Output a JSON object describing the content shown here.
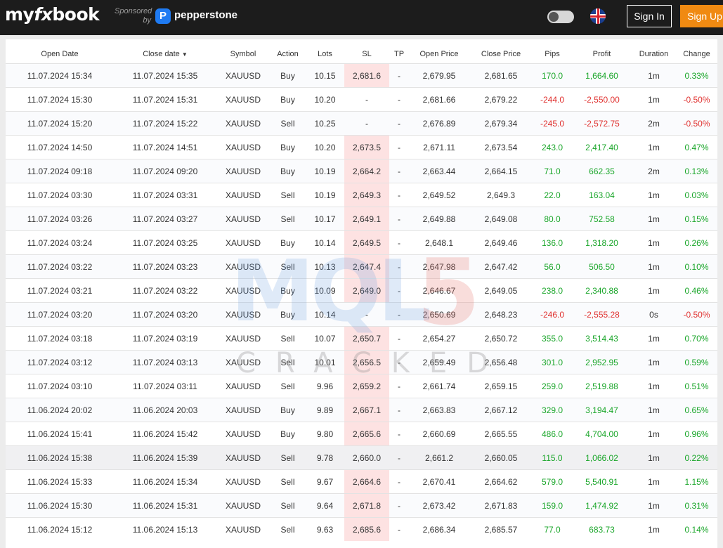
{
  "header": {
    "logo_my": "my",
    "logo_fx": "fx",
    "logo_book": "book",
    "sponsored_line1": "Sponsored",
    "sponsored_line2": "by",
    "sponsor_name": "pepperstone",
    "theme_toggle_icon": "toggle-icon",
    "language_icon": "uk-flag-icon",
    "signin_label": "Sign In",
    "signup_label": "Sign Up"
  },
  "table": {
    "columns": [
      "Open Date",
      "Close date",
      "Symbol",
      "Action",
      "Lots",
      "SL",
      "TP",
      "Open Price",
      "Close Price",
      "Pips",
      "Profit",
      "Duration",
      "Change"
    ],
    "sorted_column_marker": "▼",
    "rows": [
      {
        "open_date": "11.07.2024 15:34",
        "close_date": "11.07.2024 15:35",
        "symbol": "XAUUSD",
        "action": "Buy",
        "lots": "10.15",
        "sl": "2,681.6",
        "tp": "-",
        "open_price": "2,679.95",
        "close_price": "2,681.65",
        "pips": "170.0",
        "profit": "1,664.60",
        "duration": "1m",
        "change": "0.33%",
        "positive": true,
        "sl_hit": true
      },
      {
        "open_date": "11.07.2024 15:30",
        "close_date": "11.07.2024 15:31",
        "symbol": "XAUUSD",
        "action": "Buy",
        "lots": "10.20",
        "sl": "-",
        "tp": "-",
        "open_price": "2,681.66",
        "close_price": "2,679.22",
        "pips": "-244.0",
        "profit": "-2,550.00",
        "duration": "1m",
        "change": "-0.50%",
        "positive": false,
        "sl_hit": false
      },
      {
        "open_date": "11.07.2024 15:20",
        "close_date": "11.07.2024 15:22",
        "symbol": "XAUUSD",
        "action": "Sell",
        "lots": "10.25",
        "sl": "-",
        "tp": "-",
        "open_price": "2,676.89",
        "close_price": "2,679.34",
        "pips": "-245.0",
        "profit": "-2,572.75",
        "duration": "2m",
        "change": "-0.50%",
        "positive": false,
        "sl_hit": false
      },
      {
        "open_date": "11.07.2024 14:50",
        "close_date": "11.07.2024 14:51",
        "symbol": "XAUUSD",
        "action": "Buy",
        "lots": "10.20",
        "sl": "2,673.5",
        "tp": "-",
        "open_price": "2,671.11",
        "close_price": "2,673.54",
        "pips": "243.0",
        "profit": "2,417.40",
        "duration": "1m",
        "change": "0.47%",
        "positive": true,
        "sl_hit": true
      },
      {
        "open_date": "11.07.2024 09:18",
        "close_date": "11.07.2024 09:20",
        "symbol": "XAUUSD",
        "action": "Buy",
        "lots": "10.19",
        "sl": "2,664.2",
        "tp": "-",
        "open_price": "2,663.44",
        "close_price": "2,664.15",
        "pips": "71.0",
        "profit": "662.35",
        "duration": "2m",
        "change": "0.13%",
        "positive": true,
        "sl_hit": true
      },
      {
        "open_date": "11.07.2024 03:30",
        "close_date": "11.07.2024 03:31",
        "symbol": "XAUUSD",
        "action": "Sell",
        "lots": "10.19",
        "sl": "2,649.3",
        "tp": "-",
        "open_price": "2,649.52",
        "close_price": "2,649.3",
        "pips": "22.0",
        "profit": "163.04",
        "duration": "1m",
        "change": "0.03%",
        "positive": true,
        "sl_hit": true
      },
      {
        "open_date": "11.07.2024 03:26",
        "close_date": "11.07.2024 03:27",
        "symbol": "XAUUSD",
        "action": "Sell",
        "lots": "10.17",
        "sl": "2,649.1",
        "tp": "-",
        "open_price": "2,649.88",
        "close_price": "2,649.08",
        "pips": "80.0",
        "profit": "752.58",
        "duration": "1m",
        "change": "0.15%",
        "positive": true,
        "sl_hit": true
      },
      {
        "open_date": "11.07.2024 03:24",
        "close_date": "11.07.2024 03:25",
        "symbol": "XAUUSD",
        "action": "Buy",
        "lots": "10.14",
        "sl": "2,649.5",
        "tp": "-",
        "open_price": "2,648.1",
        "close_price": "2,649.46",
        "pips": "136.0",
        "profit": "1,318.20",
        "duration": "1m",
        "change": "0.26%",
        "positive": true,
        "sl_hit": true
      },
      {
        "open_date": "11.07.2024 03:22",
        "close_date": "11.07.2024 03:23",
        "symbol": "XAUUSD",
        "action": "Sell",
        "lots": "10.13",
        "sl": "2,647.4",
        "tp": "-",
        "open_price": "2,647.98",
        "close_price": "2,647.42",
        "pips": "56.0",
        "profit": "506.50",
        "duration": "1m",
        "change": "0.10%",
        "positive": true,
        "sl_hit": true
      },
      {
        "open_date": "11.07.2024 03:21",
        "close_date": "11.07.2024 03:22",
        "symbol": "XAUUSD",
        "action": "Buy",
        "lots": "10.09",
        "sl": "2,649.0",
        "tp": "-",
        "open_price": "2,646.67",
        "close_price": "2,649.05",
        "pips": "238.0",
        "profit": "2,340.88",
        "duration": "1m",
        "change": "0.46%",
        "positive": true,
        "sl_hit": true
      },
      {
        "open_date": "11.07.2024 03:20",
        "close_date": "11.07.2024 03:20",
        "symbol": "XAUUSD",
        "action": "Buy",
        "lots": "10.14",
        "sl": "-",
        "tp": "-",
        "open_price": "2,650.69",
        "close_price": "2,648.23",
        "pips": "-246.0",
        "profit": "-2,555.28",
        "duration": "0s",
        "change": "-0.50%",
        "positive": false,
        "sl_hit": false
      },
      {
        "open_date": "11.07.2024 03:18",
        "close_date": "11.07.2024 03:19",
        "symbol": "XAUUSD",
        "action": "Sell",
        "lots": "10.07",
        "sl": "2,650.7",
        "tp": "-",
        "open_price": "2,654.27",
        "close_price": "2,650.72",
        "pips": "355.0",
        "profit": "3,514.43",
        "duration": "1m",
        "change": "0.70%",
        "positive": true,
        "sl_hit": true
      },
      {
        "open_date": "11.07.2024 03:12",
        "close_date": "11.07.2024 03:13",
        "symbol": "XAUUSD",
        "action": "Sell",
        "lots": "10.01",
        "sl": "2,656.5",
        "tp": "-",
        "open_price": "2,659.49",
        "close_price": "2,656.48",
        "pips": "301.0",
        "profit": "2,952.95",
        "duration": "1m",
        "change": "0.59%",
        "positive": true,
        "sl_hit": true
      },
      {
        "open_date": "11.07.2024 03:10",
        "close_date": "11.07.2024 03:11",
        "symbol": "XAUUSD",
        "action": "Sell",
        "lots": "9.96",
        "sl": "2,659.2",
        "tp": "-",
        "open_price": "2,661.74",
        "close_price": "2,659.15",
        "pips": "259.0",
        "profit": "2,519.88",
        "duration": "1m",
        "change": "0.51%",
        "positive": true,
        "sl_hit": true
      },
      {
        "open_date": "11.06.2024 20:02",
        "close_date": "11.06.2024 20:03",
        "symbol": "XAUUSD",
        "action": "Buy",
        "lots": "9.89",
        "sl": "2,667.1",
        "tp": "-",
        "open_price": "2,663.83",
        "close_price": "2,667.12",
        "pips": "329.0",
        "profit": "3,194.47",
        "duration": "1m",
        "change": "0.65%",
        "positive": true,
        "sl_hit": true
      },
      {
        "open_date": "11.06.2024 15:41",
        "close_date": "11.06.2024 15:42",
        "symbol": "XAUUSD",
        "action": "Buy",
        "lots": "9.80",
        "sl": "2,665.6",
        "tp": "-",
        "open_price": "2,660.69",
        "close_price": "2,665.55",
        "pips": "486.0",
        "profit": "4,704.00",
        "duration": "1m",
        "change": "0.96%",
        "positive": true,
        "sl_hit": true
      },
      {
        "open_date": "11.06.2024 15:38",
        "close_date": "11.06.2024 15:39",
        "symbol": "XAUUSD",
        "action": "Sell",
        "lots": "9.78",
        "sl": "2,660.0",
        "tp": "-",
        "open_price": "2,661.2",
        "close_price": "2,660.05",
        "pips": "115.0",
        "profit": "1,066.02",
        "duration": "1m",
        "change": "0.22%",
        "positive": true,
        "sl_hit": false,
        "hover": true
      },
      {
        "open_date": "11.06.2024 15:33",
        "close_date": "11.06.2024 15:34",
        "symbol": "XAUUSD",
        "action": "Sell",
        "lots": "9.67",
        "sl": "2,664.6",
        "tp": "-",
        "open_price": "2,670.41",
        "close_price": "2,664.62",
        "pips": "579.0",
        "profit": "5,540.91",
        "duration": "1m",
        "change": "1.15%",
        "positive": true,
        "sl_hit": true
      },
      {
        "open_date": "11.06.2024 15:30",
        "close_date": "11.06.2024 15:31",
        "symbol": "XAUUSD",
        "action": "Sell",
        "lots": "9.64",
        "sl": "2,671.8",
        "tp": "-",
        "open_price": "2,673.42",
        "close_price": "2,671.83",
        "pips": "159.0",
        "profit": "1,474.92",
        "duration": "1m",
        "change": "0.31%",
        "positive": true,
        "sl_hit": true
      },
      {
        "open_date": "11.06.2024 15:12",
        "close_date": "11.06.2024 15:13",
        "symbol": "XAUUSD",
        "action": "Sell",
        "lots": "9.63",
        "sl": "2,685.6",
        "tp": "-",
        "open_price": "2,686.34",
        "close_price": "2,685.57",
        "pips": "77.0",
        "profit": "683.73",
        "duration": "1m",
        "change": "0.14%",
        "positive": true,
        "sl_hit": true
      }
    ]
  },
  "watermark": {
    "mark_text": "MQL",
    "mark_digit": "5",
    "caption": "CRACKED"
  },
  "colors": {
    "positive": "#1aa62a",
    "negative": "#e0312f",
    "sl_highlight": "#fde2e2",
    "signup_bg": "#f08a12",
    "topbar_bg": "#1c1c1c"
  }
}
